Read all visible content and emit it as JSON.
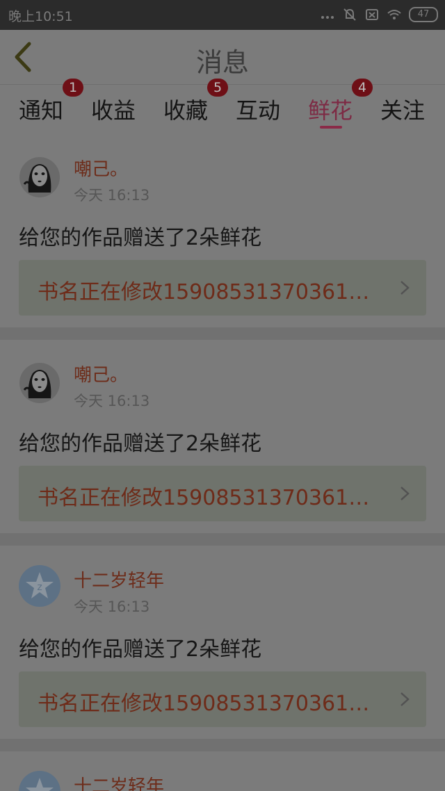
{
  "status_bar": {
    "time": "晚上10:51",
    "battery": "47",
    "icons": [
      "more-dots-icon",
      "bell-off-icon",
      "no-sim-icon",
      "wifi-icon",
      "battery-icon"
    ]
  },
  "header": {
    "title": "消息",
    "back_icon": "back-chevron-icon"
  },
  "tabs": [
    {
      "label": "通知",
      "badge": "1",
      "active": false
    },
    {
      "label": "收益",
      "badge": "",
      "active": false
    },
    {
      "label": "收藏",
      "badge": "5",
      "active": false
    },
    {
      "label": "互动",
      "badge": "",
      "active": false
    },
    {
      "label": "鲜花",
      "badge": "4",
      "active": true
    },
    {
      "label": "关注",
      "badge": "",
      "active": false
    }
  ],
  "messages": [
    {
      "user": "嘲己。",
      "time": "今天 16:13",
      "text": "给您的作品赠送了2朵鲜花",
      "book": "书名正在修改15908531370361…",
      "avatar": "noface-avatar-icon"
    },
    {
      "user": "嘲己。",
      "time": "今天 16:13",
      "text": "给您的作品赠送了2朵鲜花",
      "book": "书名正在修改15908531370361…",
      "avatar": "noface-avatar-icon"
    },
    {
      "user": "十二岁轻年",
      "time": "今天 16:13",
      "text": "给您的作品赠送了2朵鲜花",
      "book": "书名正在修改15908531370361…",
      "avatar": "default-star-avatar-icon"
    },
    {
      "user": "十二岁轻年",
      "time": "",
      "text": "",
      "book": "",
      "avatar": "default-star-avatar-icon"
    }
  ],
  "colors": {
    "active_tab": "#7d2a44",
    "badge": "#6e0f16",
    "user_name": "#6d2c1a",
    "overlay_background": "#7b7b7b"
  }
}
